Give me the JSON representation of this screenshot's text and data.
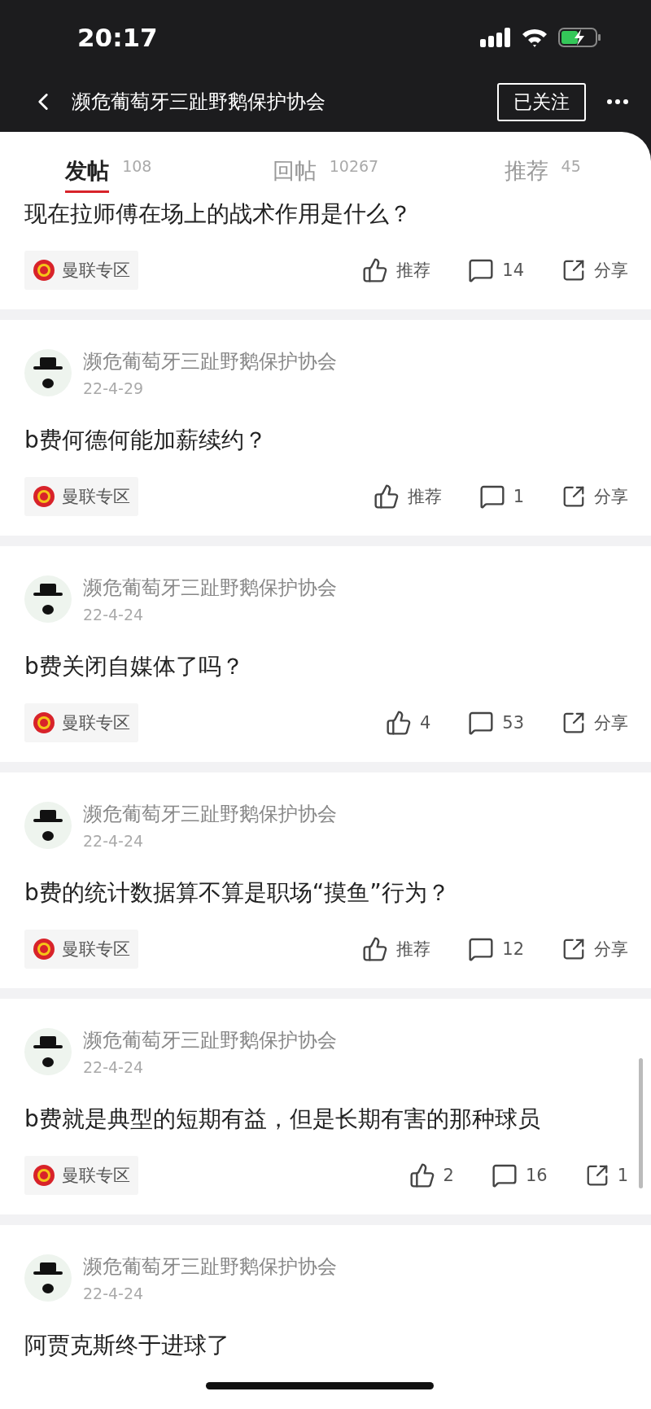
{
  "status_bar": {
    "time": "20:17"
  },
  "nav": {
    "title": "濒危葡萄牙三趾野鹅保护协会",
    "follow_button": "已关注"
  },
  "tabs": [
    {
      "label": "发帖",
      "count": "108",
      "selected": true
    },
    {
      "label": "回帖",
      "count": "10267",
      "selected": false
    },
    {
      "label": "推荐",
      "count": "45",
      "selected": false
    }
  ],
  "posts": [
    {
      "title": "现在拉师傅在场上的战术作用是什么？",
      "tag": "曼联专区",
      "likes": "推荐",
      "comments": "14",
      "share": "分享"
    },
    {
      "author": "濒危葡萄牙三趾野鹅保护协会",
      "date": "22-4-29",
      "title": "b费何德何能加薪续约？",
      "tag": "曼联专区",
      "likes": "推荐",
      "comments": "1",
      "share": "分享"
    },
    {
      "author": "濒危葡萄牙三趾野鹅保护协会",
      "date": "22-4-24",
      "title": "b费关闭自媒体了吗？",
      "tag": "曼联专区",
      "likes": "4",
      "comments": "53",
      "share": "分享"
    },
    {
      "author": "濒危葡萄牙三趾野鹅保护协会",
      "date": "22-4-24",
      "title": "b费的统计数据算不算是职场“摸鱼”行为？",
      "tag": "曼联专区",
      "likes": "推荐",
      "comments": "12",
      "share": "分享"
    },
    {
      "author": "濒危葡萄牙三趾野鹅保护协会",
      "date": "22-4-24",
      "title": "b费就是典型的短期有益，但是长期有害的那种球员",
      "tag": "曼联专区",
      "likes": "2",
      "comments": "16",
      "share": "1"
    },
    {
      "author": "濒危葡萄牙三趾野鹅保护协会",
      "date": "22-4-24",
      "title": "阿贾克斯终于进球了"
    }
  ]
}
